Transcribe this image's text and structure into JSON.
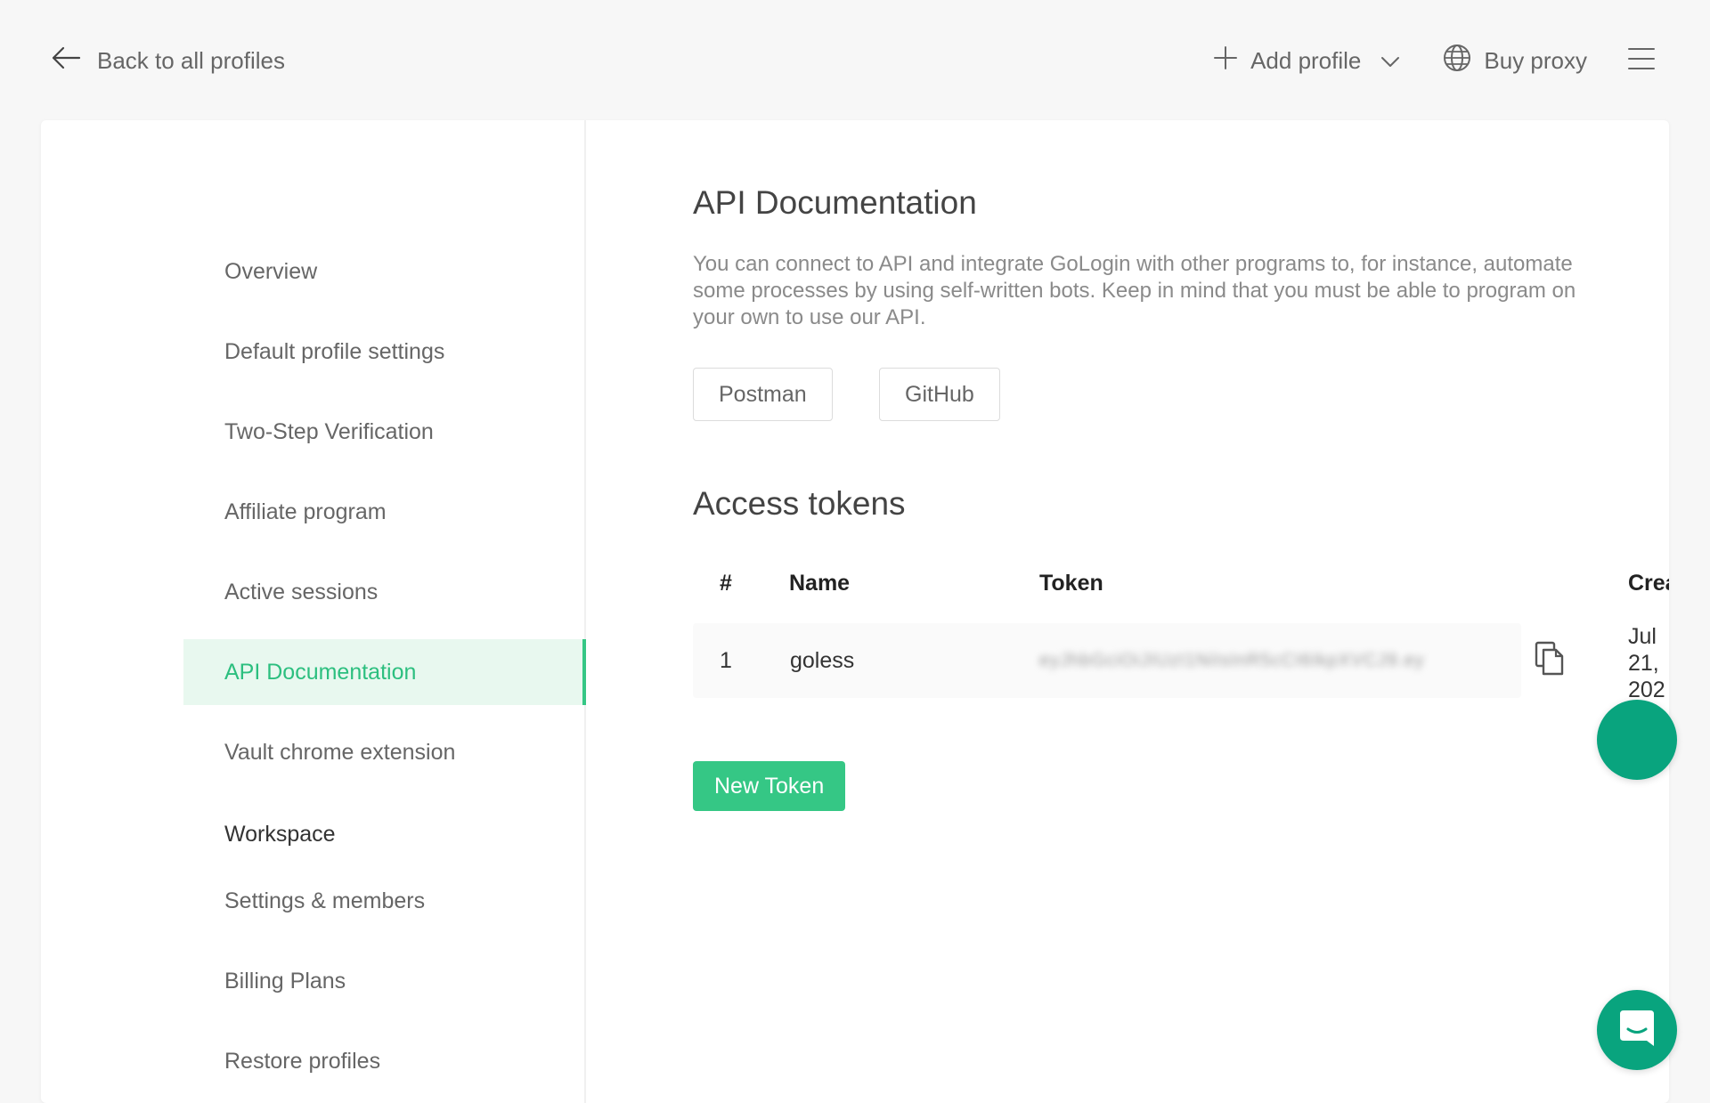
{
  "topbar": {
    "back_label": "Back to all profiles",
    "add_profile_label": "Add profile",
    "buy_proxy_label": "Buy proxy"
  },
  "sidebar": {
    "items": [
      {
        "label": "Overview"
      },
      {
        "label": "Default profile settings"
      },
      {
        "label": "Two-Step Verification"
      },
      {
        "label": "Affiliate program"
      },
      {
        "label": "Active sessions"
      },
      {
        "label": "API Documentation",
        "active": true
      },
      {
        "label": "Vault chrome extension"
      }
    ],
    "workspace_heading": "Workspace",
    "workspace_items": [
      {
        "label": "Settings & members"
      },
      {
        "label": "Billing Plans"
      },
      {
        "label": "Restore profiles"
      }
    ]
  },
  "main": {
    "title": "API Documentation",
    "description": "You can connect to API and integrate GoLogin with other programs to, for instance, automate some processes by using self-written bots. Keep in mind that you must be able to program on your own to use our API.",
    "buttons": {
      "postman": "Postman",
      "github": "GitHub"
    },
    "tokens_title": "Access tokens",
    "table": {
      "columns": [
        "#",
        "Name",
        "Token",
        "Crea"
      ],
      "rows": [
        {
          "index": "1",
          "name": "goless",
          "token": "eyJhbGciOiJIUzI1NiIsInR5cCI6IkpXVCJ9.ey",
          "created": "Jul 21, 202"
        }
      ]
    },
    "new_token_label": "New Token"
  },
  "colors": {
    "accent": "#35c785",
    "accent_light": "#e8f8ef",
    "fab": "#09a47e"
  }
}
